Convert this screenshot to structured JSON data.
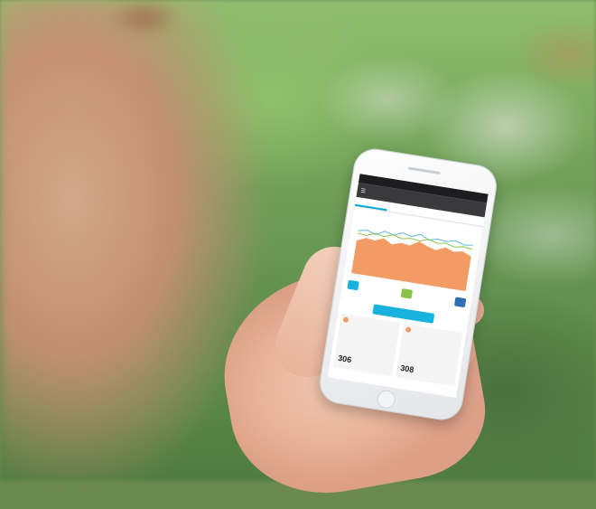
{
  "scene": {
    "description_colors": {
      "foliage": "#6f9e58",
      "accent": "#18b2de",
      "chart_fill": "#f39b64"
    }
  },
  "phone": {
    "statusbar": {
      "left": "",
      "right": ""
    },
    "appbar": {
      "title": ""
    },
    "tabs": [
      {
        "label": "",
        "active": true
      },
      {
        "label": ""
      },
      {
        "label": ""
      },
      {
        "label": ""
      }
    ],
    "cta_label": "",
    "cards": [
      {
        "label": "",
        "value": "306",
        "unit": ""
      },
      {
        "label": "",
        "value": "308",
        "unit": ""
      }
    ]
  },
  "chart_data": {
    "type": "area",
    "values": [
      0.55,
      0.62,
      0.6,
      0.66,
      0.58,
      0.63,
      0.61,
      0.7,
      0.64,
      0.6,
      0.67,
      0.62,
      0.65,
      0.59
    ],
    "line1": [
      0.72,
      0.75,
      0.7,
      0.78,
      0.74,
      0.8,
      0.76,
      0.82,
      0.75,
      0.79,
      0.77,
      0.81,
      0.76,
      0.78
    ],
    "line2": [
      0.68,
      0.66,
      0.72,
      0.69,
      0.74,
      0.7,
      0.73,
      0.71,
      0.76,
      0.72,
      0.74,
      0.7,
      0.73,
      0.71
    ],
    "colors": {
      "area": "#f39b64",
      "line1": "#5fb8d9",
      "line2": "#8bc34a"
    }
  }
}
